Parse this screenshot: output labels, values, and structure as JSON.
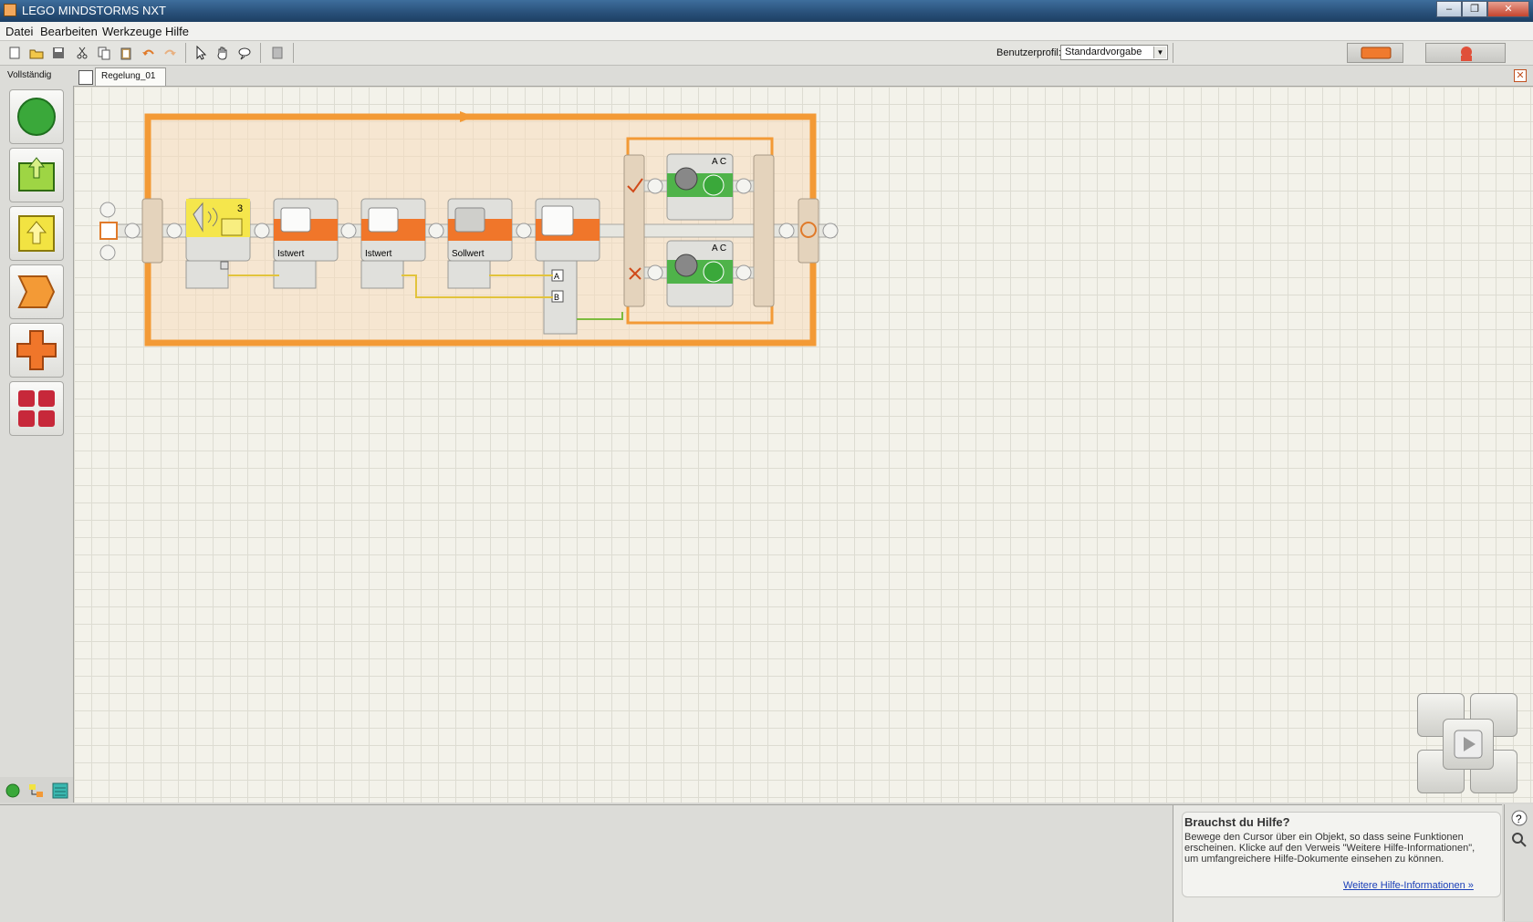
{
  "window": {
    "title": "LEGO MINDSTORMS NXT"
  },
  "menu": [
    "Datei",
    "Bearbeiten",
    "Werkzeuge",
    "Hilfe"
  ],
  "toolbar": {
    "profile_label": "Benutzerprofil:",
    "profile_value": "Standardvorgabe"
  },
  "palette": {
    "label": "Vollständig",
    "items": [
      "action-block",
      "sensor-output",
      "sensor-input",
      "flow-block",
      "data-block",
      "advanced-block"
    ]
  },
  "tabs": {
    "active": "Regelung_01"
  },
  "program": {
    "blocks": [
      {
        "label": "",
        "badge": "3"
      },
      {
        "label": "Istwert"
      },
      {
        "label": "Istwert"
      },
      {
        "label": "Sollwert"
      }
    ],
    "motor_ports_top": "A C",
    "motor_ports_bottom": "A C",
    "compare_ports": [
      "A",
      "B"
    ]
  },
  "help": {
    "title": "Brauchst du Hilfe?",
    "text": "Bewege den Cursor über ein Objekt, so dass seine Funktionen erscheinen. Klicke auf den Verweis \"Weitere Hilfe-Informationen\", um umfangreichere Hilfe-Dokumente einsehen zu können.",
    "link": "Weitere Hilfe-Informationen »"
  },
  "colors": {
    "orange": "#f39a36",
    "sensor_yellow": "#f5e64c",
    "motor_green": "#4fb34a",
    "palette_red": "#c7283a"
  }
}
